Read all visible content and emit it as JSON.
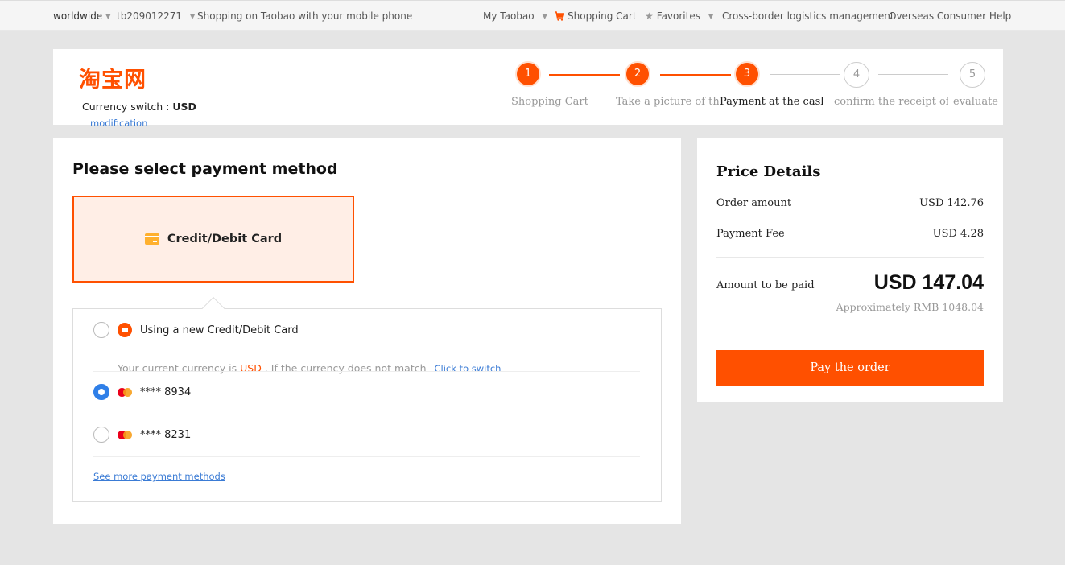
{
  "topbar": {
    "region": "worldwide",
    "username": "tb209012271",
    "mobile": "Shopping on Taobao with your mobile phone",
    "my_taobao": "My Taobao",
    "cart": "Shopping Cart",
    "favorites": "Favorites",
    "logistics": "Cross-border logistics management",
    "help": "Overseas Consumer Help"
  },
  "header": {
    "logo": "淘宝网",
    "currency_label": "Currency switch :",
    "currency_value": "USD",
    "modify_link": "modification",
    "steps": [
      {
        "num": "1",
        "label": "Shopping Cart",
        "state": "done"
      },
      {
        "num": "2",
        "label": "Take a picture of the p...",
        "state": "done"
      },
      {
        "num": "3",
        "label": "Payment at the cashier",
        "state": "current"
      },
      {
        "num": "4",
        "label": "confirm the receipt of ...",
        "state": "todo"
      },
      {
        "num": "5",
        "label": "evaluate",
        "state": "todo"
      }
    ]
  },
  "payment": {
    "title": "Please select payment method",
    "method_tab": "Credit/Debit Card",
    "new_card_label": "Using a new Credit/Debit Card",
    "hint_prefix": "Your current currency is",
    "hint_currency": "USD",
    "hint_suffix": ". If the currency does not match",
    "switch_link": "Click to switch",
    "cards": [
      {
        "label": "**** 8934",
        "selected": true
      },
      {
        "label": "**** 8231",
        "selected": false
      }
    ],
    "more_link": "See more payment methods"
  },
  "price": {
    "title": "Price Details",
    "order_amount_label": "Order amount",
    "order_amount_value": "USD 142.76",
    "fee_label": "Payment Fee",
    "fee_value": "USD 4.28",
    "total_label": "Amount to be paid",
    "total_value": "USD 147.04",
    "approx": "Approximately RMB 1048.04",
    "pay_button": "Pay the order"
  },
  "colors": {
    "accent": "#ff5000",
    "link": "#3a7bd5",
    "radio_selected": "#2f7fe8"
  }
}
